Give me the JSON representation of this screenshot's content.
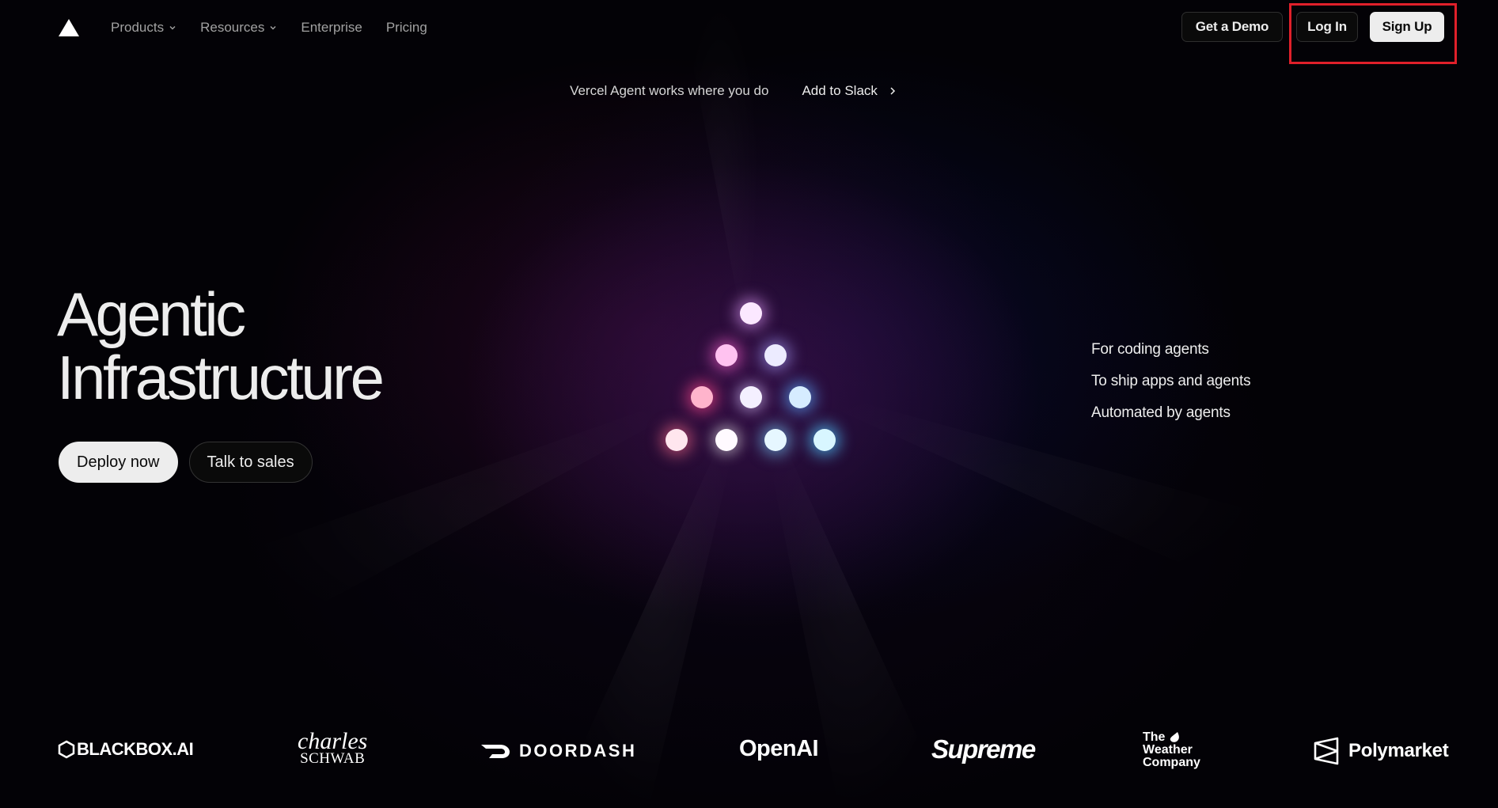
{
  "nav": {
    "links": [
      {
        "label": "Products",
        "has_dropdown": true
      },
      {
        "label": "Resources",
        "has_dropdown": true
      },
      {
        "label": "Enterprise",
        "has_dropdown": false
      },
      {
        "label": "Pricing",
        "has_dropdown": false
      }
    ],
    "demo_label": "Get a Demo",
    "login_label": "Log In",
    "signup_label": "Sign Up"
  },
  "announcement": {
    "text": "Vercel Agent works where you do",
    "link_label": "Add to Slack"
  },
  "hero": {
    "title_line1": "Agentic",
    "title_line2": "Infrastructure",
    "primary_button": "Deploy now",
    "secondary_button": "Talk to sales"
  },
  "taglines": [
    "For coding agents",
    "To ship apps and agents",
    "Automated by agents"
  ],
  "logos": [
    {
      "name": "blackbox-logo",
      "text": "BLACKBOX.AI"
    },
    {
      "name": "charles-schwab-logo",
      "text_top": "charles",
      "text_bottom": "SCHWAB"
    },
    {
      "name": "doordash-logo",
      "text": "DOORDASH"
    },
    {
      "name": "openai-logo",
      "text": "OpenAI"
    },
    {
      "name": "supreme-logo",
      "text": "Supreme"
    },
    {
      "name": "weather-company-logo",
      "lines": [
        "The",
        "Weather",
        "Company"
      ]
    },
    {
      "name": "polymarket-logo",
      "text": "Polymarket"
    }
  ],
  "colors": {
    "background": "#030206",
    "text": "#ededed",
    "muted": "#a1a1a1",
    "highlight": "#e0202a"
  },
  "icons": {
    "logo": "vercel-triangle-icon",
    "dropdown": "chevron-down-icon",
    "link_arrow": "chevron-right-icon"
  }
}
